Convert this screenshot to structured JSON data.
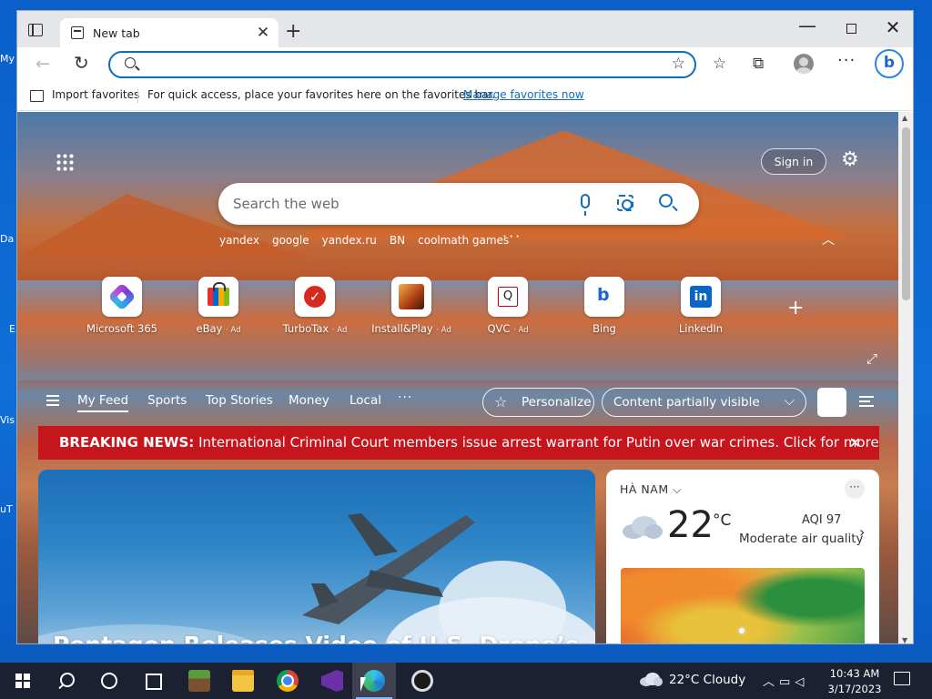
{
  "desktop": {
    "icon_labels": [
      "My",
      "Da",
      "E",
      "Vis",
      "uT"
    ]
  },
  "browser": {
    "tab": {
      "title": "New tab"
    },
    "address_bar": {
      "value": "",
      "placeholder": ""
    },
    "favorites_bar": {
      "import_label": "Import favorites",
      "message": "For quick access, place your favorites here on the favorites bar.",
      "manage_link": "Manage favorites now"
    }
  },
  "newtab": {
    "sign_in_label": "Sign in",
    "search": {
      "placeholder": "Search the web"
    },
    "quick_searches": [
      "yandex",
      "google",
      "yandex.ru",
      "BN",
      "coolmath games"
    ],
    "quick_links": [
      {
        "label": "Microsoft 365",
        "ad": "",
        "icon": "microsoft-365-icon"
      },
      {
        "label": "eBay",
        "ad": "· Ad",
        "icon": "ebay-icon"
      },
      {
        "label": "TurboTax",
        "ad": "· Ad",
        "icon": "turbotax-icon"
      },
      {
        "label": "Install&Play",
        "ad": "· Ad",
        "icon": "install-play-icon"
      },
      {
        "label": "QVC",
        "ad": "· Ad",
        "icon": "qvc-icon"
      },
      {
        "label": "Bing",
        "ad": "",
        "icon": "bing-icon"
      },
      {
        "label": "LinkedIn",
        "ad": "",
        "icon": "linkedin-icon"
      }
    ],
    "feed_tabs": [
      "My Feed",
      "Sports",
      "Top Stories",
      "Money",
      "Local"
    ],
    "personalize_label": "Personalize",
    "content_visibility_label": "Content partially visible",
    "breaking_news": {
      "label": "BREAKING NEWS:",
      "text": "International Criminal Court members issue arrest warrant for Putin over war crimes. Click for more..."
    },
    "hero_headline": "Pentagon Releases Video of U.S. Drone’s",
    "weather": {
      "location": "HÀ NAM",
      "temperature": "22",
      "unit": "°C",
      "aqi": "AQI 97",
      "air_quality": "Moderate air quality"
    }
  },
  "taskbar": {
    "weather": "22°C  Cloudy",
    "time": "10:43 AM",
    "date": "3/17/2023"
  },
  "colors": {
    "accent": "#0f6cbd",
    "breaking_news_bg": "#c4161c",
    "taskbar_bg": "#1c2131",
    "desktop_bg": "#0f6fd8"
  }
}
